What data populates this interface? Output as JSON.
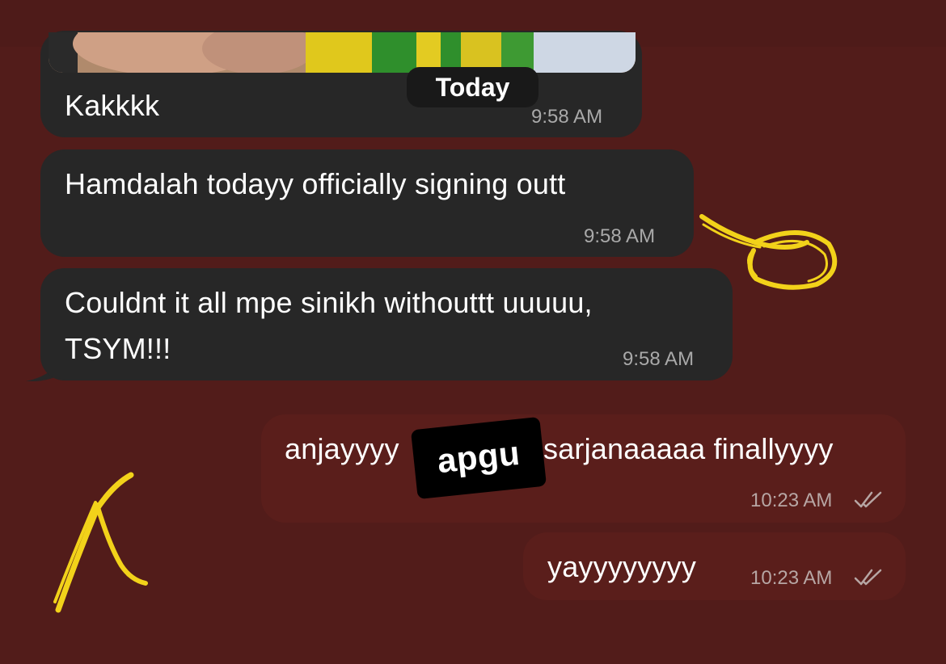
{
  "date_divider": "Today",
  "messages": [
    {
      "direction": "incoming",
      "text": "Kakkkk",
      "time": "9:58 AM",
      "has_photo": true
    },
    {
      "direction": "incoming",
      "text": "Hamdalah todayy officially signing outt",
      "time": "9:58 AM"
    },
    {
      "direction": "incoming",
      "text_line1": "Couldnt it all mpe sinikh withouttt uuuuu,",
      "text_line2": "TSYM!!!",
      "time": "9:58 AM"
    },
    {
      "direction": "outgoing",
      "text_part1": "anjayyyy",
      "text_part2": "sarjanaaaaa finallyyyy",
      "time": "10:23 AM",
      "status_icon": "double-check-icon"
    },
    {
      "direction": "outgoing",
      "text": "yayyyyyyyy",
      "time": "10:23 AM",
      "status_icon": "double-check-icon"
    }
  ],
  "sticker": {
    "text": "apgu"
  },
  "colors": {
    "background": "#521c1a",
    "incoming_bubble": "#272727",
    "outgoing_bubble": "#5a1e1b",
    "annotation": "#f2d21a"
  }
}
